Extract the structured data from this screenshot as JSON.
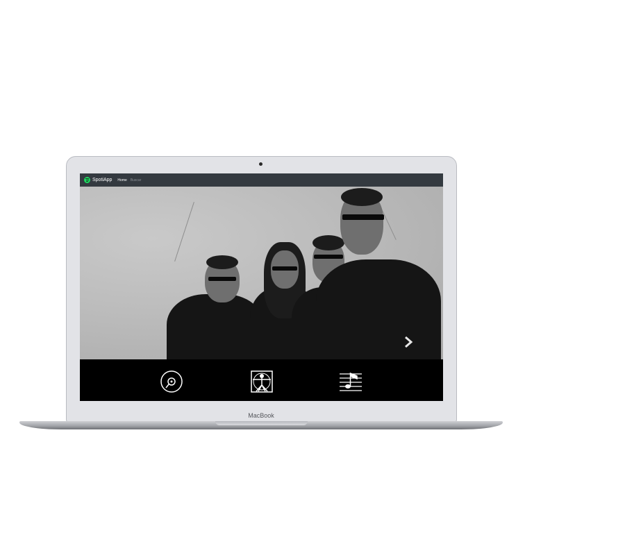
{
  "device": {
    "label": "MacBook"
  },
  "navbar": {
    "brand": "SpotiApp",
    "links": [
      {
        "label": "Home",
        "active": true
      },
      {
        "label": "Buscar",
        "active": false
      }
    ]
  },
  "hero": {
    "next_icon": "chevron-right-icon"
  },
  "features": [
    {
      "icon": "vinyl-record-icon"
    },
    {
      "icon": "vitruvian-man-icon"
    },
    {
      "icon": "music-staff-icon"
    }
  ],
  "colors": {
    "navbar": "#343a40",
    "brand_logo": "#1ed760",
    "feature_bar": "#000000"
  }
}
